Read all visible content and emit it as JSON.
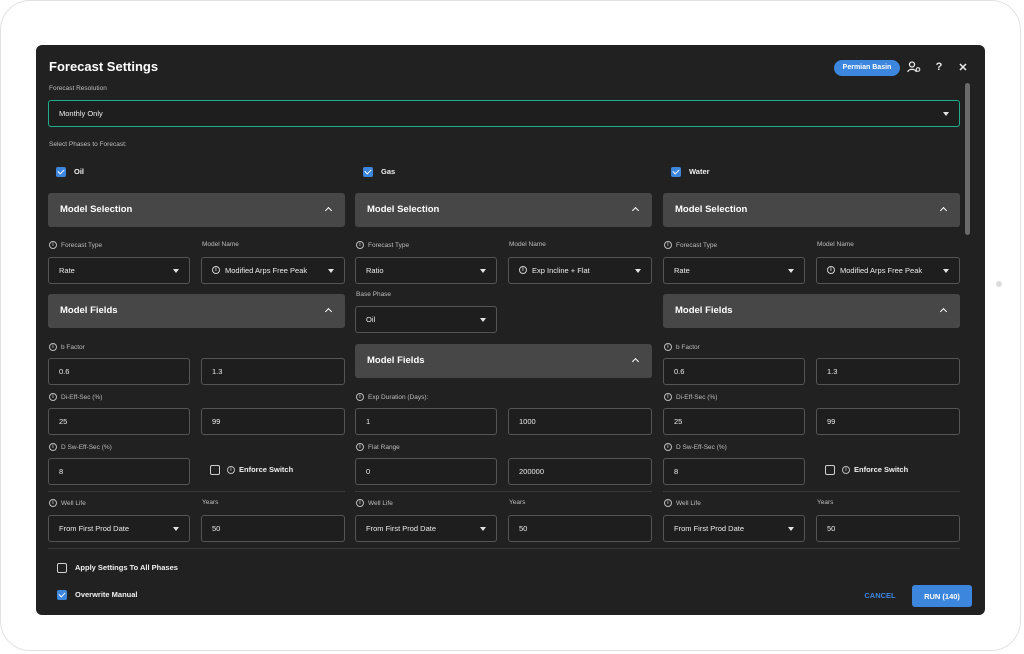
{
  "dialog": {
    "title": "Forecast Settings",
    "basin_badge": "Permian Basin",
    "icons": [
      "user-settings-icon",
      "help-icon",
      "close-icon"
    ],
    "close_glyph": "✕",
    "help_glyph": "?"
  },
  "resolution": {
    "label": "Forecast Resolution",
    "value": "Monthly Only"
  },
  "phases_label": "Select Phases to Forecast:",
  "info_glyph": "i",
  "colors": {
    "accent": "#3d86de",
    "focus": "#1fae8e",
    "panel": "#212121",
    "section": "#474747"
  },
  "oil": {
    "label": "Oil",
    "checked": true,
    "section_title": "Model Selection",
    "forecast_type_label": "Forecast Type",
    "forecast_type": "Rate",
    "model_name_label": "Model Name",
    "model_name": "Modified Arps Free Peak",
    "fields_title": "Model Fields",
    "b_factor_label": "b Factor",
    "b_factor_min": "0.6",
    "b_factor_max": "1.3",
    "di_label": "Di-Eff-Sec (%)",
    "di_min": "25",
    "di_max": "99",
    "dsw_label": "D Sw-Eff-Sec (%)",
    "dsw_value": "8",
    "enforce_label": "Enforce Switch",
    "well_life_label": "Well Life",
    "well_life": "From First Prod Date",
    "years_label": "Years",
    "years": "50"
  },
  "gas": {
    "label": "Gas",
    "checked": true,
    "section_title": "Model Selection",
    "forecast_type_label": "Forecast Type",
    "forecast_type": "Ratio",
    "model_name_label": "Model Name",
    "model_name": "Exp Incline + Flat",
    "base_phase_label": "Base Phase",
    "base_phase": "Oil",
    "fields_title": "Model Fields",
    "exp_label": "Exp Duration (Days):",
    "exp_min": "1",
    "exp_max": "1000",
    "flat_label": "Flat Range",
    "flat_min": "0",
    "flat_max": "200000",
    "well_life_label": "Well Life",
    "well_life": "From First Prod Date",
    "years_label": "Years",
    "years": "50"
  },
  "water": {
    "label": "Water",
    "checked": true,
    "section_title": "Model Selection",
    "forecast_type_label": "Forecast Type",
    "forecast_type": "Rate",
    "model_name_label": "Model Name",
    "model_name": "Modified Arps Free Peak",
    "fields_title": "Model Fields",
    "b_factor_label": "b Factor",
    "b_factor_min": "0.6",
    "b_factor_max": "1.3",
    "di_label": "Di-Eff-Sec (%)",
    "di_min": "25",
    "di_max": "99",
    "dsw_label": "D Sw-Eff-Sec (%)",
    "dsw_value": "8",
    "enforce_label": "Enforce Switch",
    "well_life_label": "Well Life",
    "well_life": "From First Prod Date",
    "years_label": "Years",
    "years": "50"
  },
  "footer": {
    "apply_all_label": "Apply Settings To All Phases",
    "apply_all_checked": false,
    "overwrite_label": "Overwrite Manual",
    "overwrite_checked": true,
    "cancel_label": "CANCEL",
    "run_label": "RUN (140)"
  }
}
